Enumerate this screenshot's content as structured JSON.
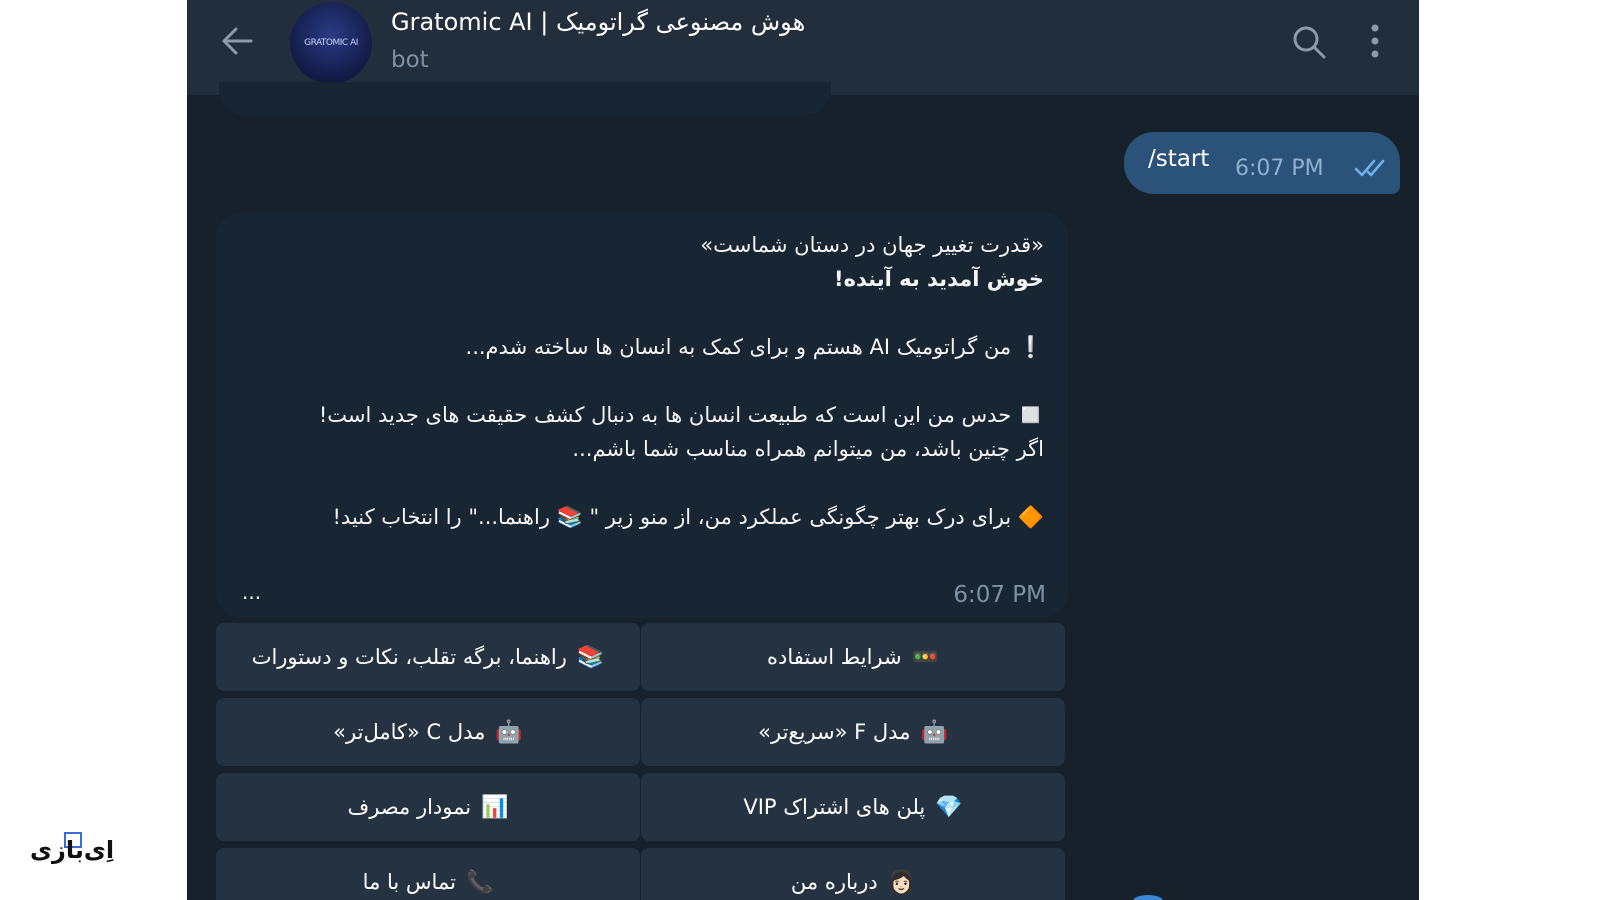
{
  "header": {
    "title": "Gratomic AI | هوش مصنوعی گراتومیک",
    "subtitle": "bot",
    "avatar_text": "GRATOMIC AI"
  },
  "outgoing": {
    "text": "/start",
    "time": "6:07 PM"
  },
  "incoming": {
    "lines": [
      "«قدرت تغییر جهان در دستان شماست»",
      "خوش آمدید به آینده!",
      "❕ من گراتومیک AI هستم و برای کمک به انسان ها ساخته شدم...",
      "◻️ حدس من این است که طبیعت انسان ها به دنبال کشف حقیقت های جدید است!",
      "اگر چنین باشد، من میتوانم همراه مناسب شما باشم...",
      "🔶 برای درک بهتر چگونگی عملکرد من، از منو زیر \" 📚 راهنما...\" را انتخاب کنید!"
    ],
    "ellipsis": "...",
    "time": "6:07 PM"
  },
  "keyboard": [
    {
      "icon": "🚥",
      "label": "شرایط استفاده"
    },
    {
      "icon": "📚",
      "label": "راهنما، برگه تقلب، نکات و دستورات"
    },
    {
      "icon": "🤖",
      "label": "مدل F «سریع‌تر»"
    },
    {
      "icon": "🤖",
      "label": "مدل C «کامل‌تر»"
    },
    {
      "icon": "💎",
      "label": "پلن های اشتراک VIP"
    },
    {
      "icon": "📊",
      "label": "نمودار مصرف"
    },
    {
      "icon": "👩🏻",
      "label": "درباره من"
    },
    {
      "icon": "📞",
      "label": "تماس با ما"
    }
  ],
  "watermark": {
    "text": "اِی‌بازی"
  },
  "colors": {
    "chat_bg": "#17212b",
    "header_bg": "#232e3c",
    "outgoing_bubble": "#2b5278",
    "incoming_bubble": "#182533",
    "keyboard_button": "#243242"
  }
}
